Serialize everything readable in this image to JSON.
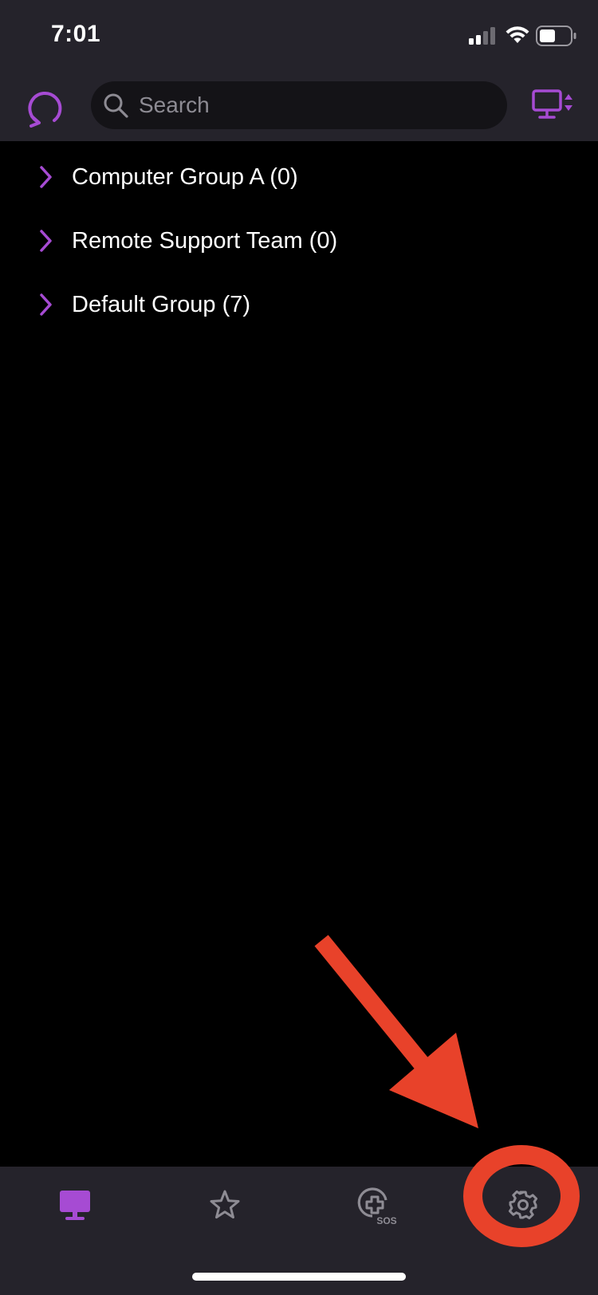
{
  "status_bar": {
    "time": "7:01",
    "icons": [
      "cellular-signal-icon",
      "wifi-icon",
      "battery-icon"
    ]
  },
  "toolbar": {
    "refresh_icon": "refresh-icon",
    "search": {
      "placeholder": "Search",
      "value": ""
    },
    "view_toggle_icon": "computer-sort-icon"
  },
  "groups": [
    {
      "label": "Computer Group A (0)"
    },
    {
      "label": "Remote Support Team (0)"
    },
    {
      "label": "Default Group (7)"
    }
  ],
  "tab_bar": {
    "tabs": [
      {
        "icon": "computer-icon",
        "selected": true
      },
      {
        "icon": "star-icon",
        "selected": false
      },
      {
        "icon": "sos-icon",
        "selected": false,
        "badge_text": "SOS"
      },
      {
        "icon": "gear-icon",
        "selected": false
      }
    ]
  },
  "annotation": {
    "type": "red arrow and circle highlighting the settings tab"
  },
  "colors": {
    "accent": "#a64bd3",
    "header_bg": "#25232b",
    "list_bg": "#000000",
    "inactive_icon": "#8e8c94",
    "annotation_red": "#e8422a"
  }
}
